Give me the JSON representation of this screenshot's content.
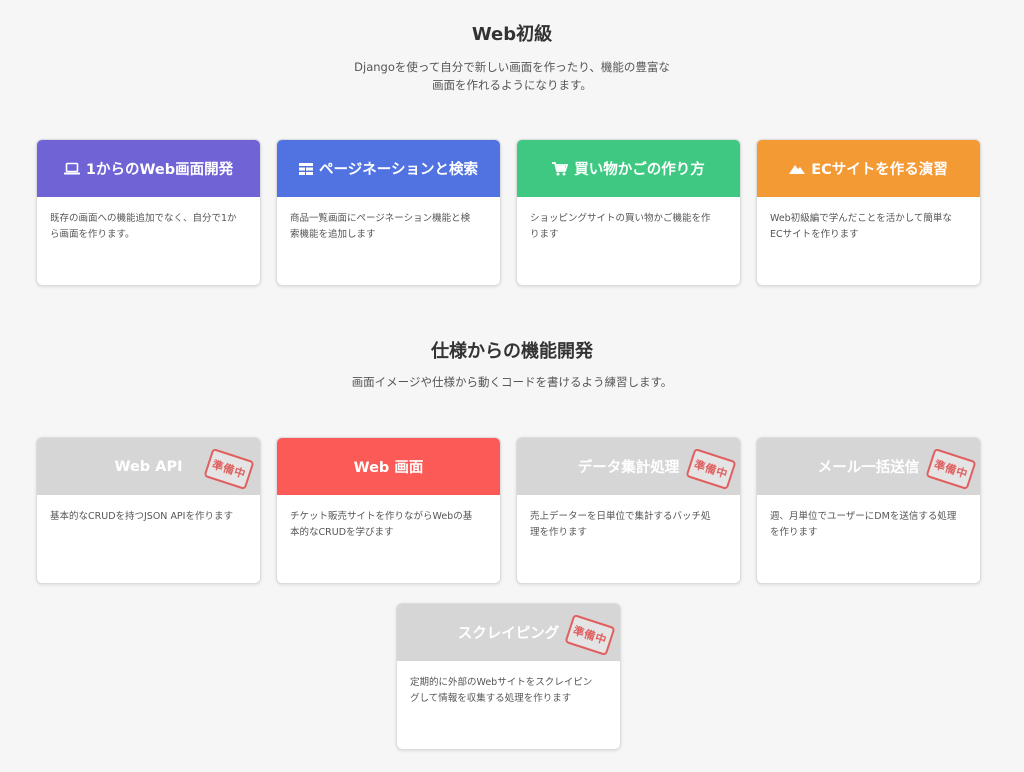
{
  "section1": {
    "title": "Web初級",
    "desc_line1": "Djangoを使って自分で新しい画面を作ったり、機能の豊富な",
    "desc_line2": "画面を作れるようになります。"
  },
  "section1_cards": [
    {
      "title": "1からのWeb画面開発",
      "icon": "laptop-icon",
      "color": "#6f63d6",
      "line1": "既存の画面への機能追加でなく、自分で1か",
      "line2": "ら画面を作ります。"
    },
    {
      "title": "ページネーションと検索",
      "icon": "table-icon",
      "color": "#5073e1",
      "line1": "商品一覧画面にページネーション機能と検",
      "line2": "索機能を追加します"
    },
    {
      "title": "買い物かごの作り方",
      "icon": "cart-icon",
      "color": "#3fc882",
      "line1": "ショッピングサイトの買い物かご機能を作",
      "line2": "ります"
    },
    {
      "title": "ECサイトを作る演習",
      "icon": "mountain-icon",
      "color": "#f49a35",
      "line1": "Web初級編で学んだことを活かして簡単な",
      "line2": "ECサイトを作ります"
    }
  ],
  "section2": {
    "title": "仕様からの機能開発",
    "desc_line1": "画面イメージや仕様から動くコードを書けるよう練習します。"
  },
  "stamp_label": "準備中",
  "section2_cards": [
    {
      "title": "Web API",
      "color": "#d6d6d6",
      "status": "準備中",
      "line1": "基本的なCRUDを持つJSON APIを作ります",
      "line2": ""
    },
    {
      "title": "Web 画面",
      "color": "#fb5a56",
      "status": "",
      "line1": "チケット販売サイトを作りながらWebの基",
      "line2": "本的なCRUDを学びます"
    },
    {
      "title": "データ集計処理",
      "color": "#d6d6d6",
      "status": "準備中",
      "line1": "売上データーを日単位で集計するバッチ処",
      "line2": "理を作ります"
    },
    {
      "title": "メール一括送信",
      "color": "#d6d6d6",
      "status": "準備中",
      "line1": "週、月単位でユーザーにDMを送信する処理",
      "line2": "を作ります"
    },
    {
      "title": "スクレイピング",
      "color": "#d6d6d6",
      "status": "準備中",
      "line1": "定期的に外部のWebサイトをスクレイピン",
      "line2": "グして情報を収集する処理を作ります"
    }
  ]
}
